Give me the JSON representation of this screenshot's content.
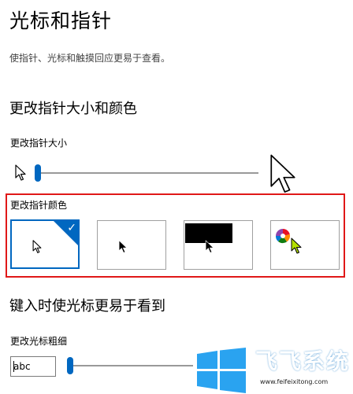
{
  "page": {
    "title": "光标和指针",
    "description": "使指针、光标和触摸回应更易于查看。"
  },
  "pointer_size": {
    "section_title": "更改指针大小和颜色",
    "label": "更改指针大小",
    "value_fraction": 0.0
  },
  "pointer_color": {
    "label": "更改指针颜色",
    "options": [
      {
        "name": "white",
        "selected": true
      },
      {
        "name": "black",
        "selected": false
      },
      {
        "name": "inverted",
        "selected": false
      },
      {
        "name": "custom",
        "selected": false
      }
    ]
  },
  "cursor": {
    "section_title": "键入时使光标更易于看到",
    "label": "更改光标粗细",
    "preview_text": "abc",
    "value_fraction": 0.0
  },
  "watermark": {
    "brand": "飞飞系统",
    "url": "www.feifeixitong.com"
  },
  "colors": {
    "accent": "#0067c0",
    "highlight": "#e01818"
  }
}
